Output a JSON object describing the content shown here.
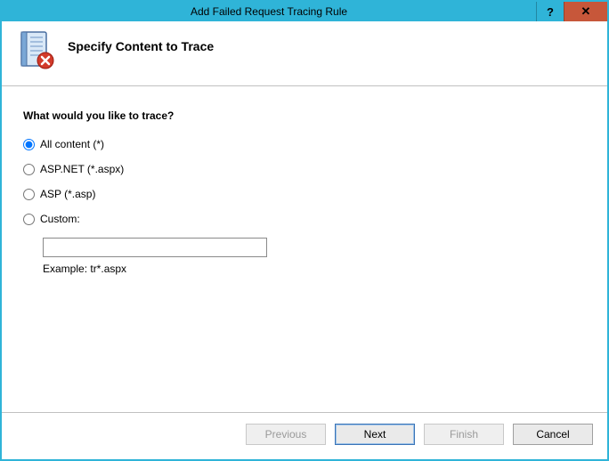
{
  "window": {
    "title": "Add Failed Request Tracing Rule"
  },
  "header": {
    "page_title": "Specify Content to Trace"
  },
  "content": {
    "question": "What would you like to trace?",
    "options": {
      "all": "All content (*)",
      "aspnet": "ASP.NET (*.aspx)",
      "asp": "ASP (*.asp)",
      "custom": "Custom:"
    },
    "selected": "all",
    "custom_value": "",
    "example_label": "Example: tr*.aspx"
  },
  "footer": {
    "previous": "Previous",
    "next": "Next",
    "finish": "Finish",
    "cancel": "Cancel"
  }
}
